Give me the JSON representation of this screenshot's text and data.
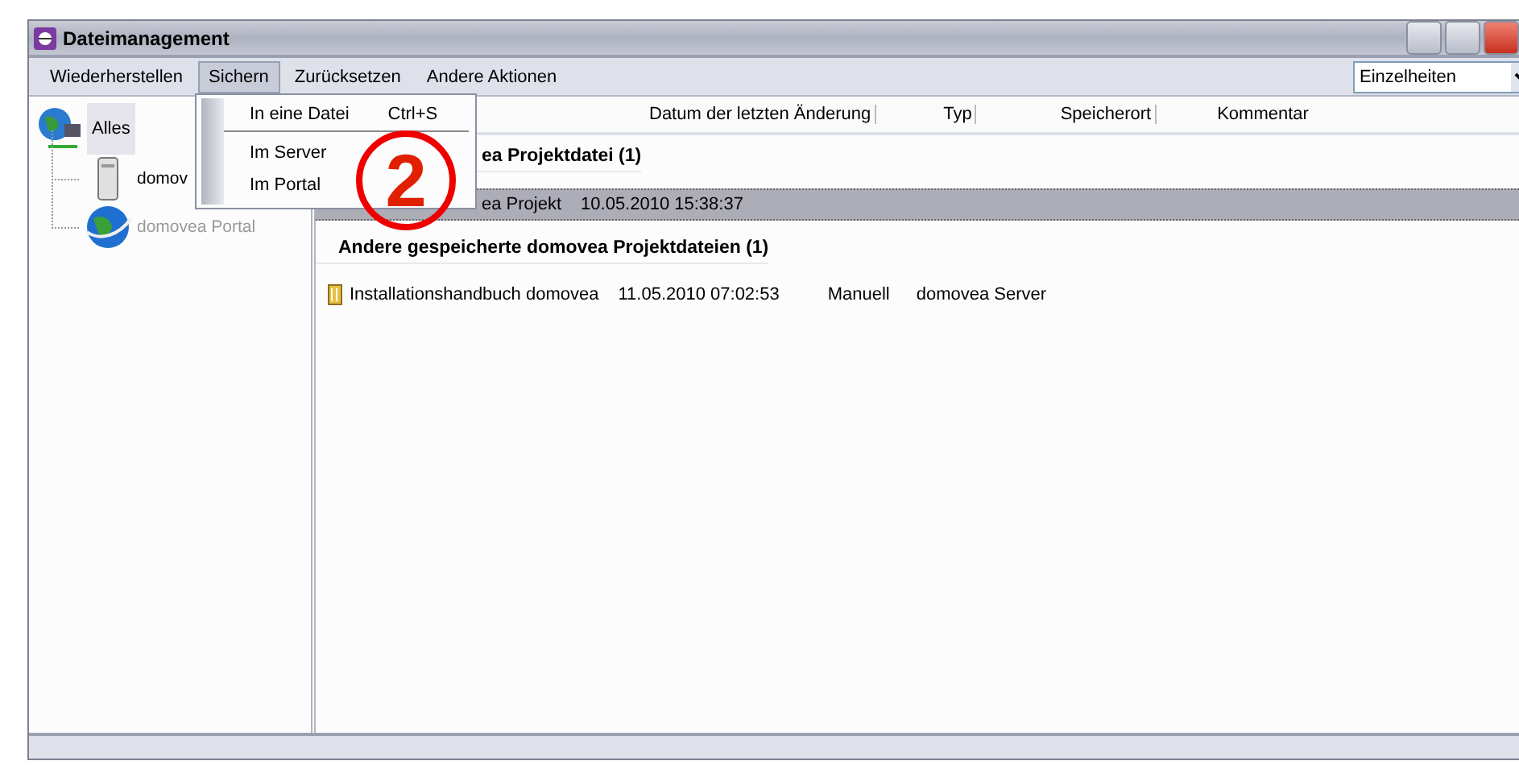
{
  "window": {
    "title": "Dateimanagement"
  },
  "menu": [
    {
      "label": "Wiederherstellen",
      "selected": false
    },
    {
      "label": "Sichern",
      "selected": true
    },
    {
      "label": "Zurücksetzen",
      "selected": false
    },
    {
      "label": "Andere Aktionen",
      "selected": false
    }
  ],
  "view_select": {
    "value": "Einzelheiten"
  },
  "open_menu": {
    "items": [
      {
        "label": "In eine Datei",
        "shortcut": "Ctrl+S",
        "separator_after": true
      },
      {
        "label": "Im Server",
        "separator_after": false
      },
      {
        "label": "Im Portal",
        "separator_after": false
      }
    ]
  },
  "tree": {
    "label": "Alles",
    "selected": true,
    "children": [
      {
        "label": "domov",
        "kind": "server",
        "disabled": false
      },
      {
        "label": "domovea Portal",
        "kind": "portal",
        "disabled": true
      }
    ]
  },
  "columns": [
    "Datum der letzten Änderung",
    "Typ",
    "Speicherort",
    "Kommentar"
  ],
  "groups": [
    {
      "title": "ea Projektdatei (1)",
      "covered": true,
      "rows": [
        {
          "name": "ea Projekt",
          "date": "10.05.2010 15:38:37",
          "selected": true
        }
      ]
    },
    {
      "title": "Andere gespeicherte domovea Projektdateien (1)",
      "covered": false,
      "rows": [
        {
          "name": "Installationshandbuch domovea",
          "date": "11.05.2010 07:02:53",
          "type": "Manuell",
          "location": "domovea Server",
          "selected": false
        }
      ]
    }
  ],
  "annotation": {
    "label": "2"
  }
}
